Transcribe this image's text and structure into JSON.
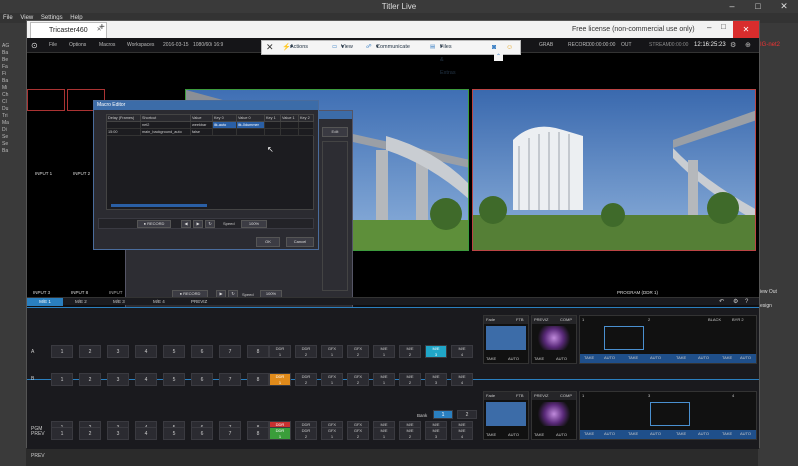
{
  "outer": {
    "title": "Titler Live",
    "menu": [
      "File",
      "View",
      "Settings",
      "Help"
    ],
    "left_items": [
      "AG",
      "Ba",
      "Be",
      "Fa",
      "Fi",
      "Ba",
      "Mi",
      "Ch",
      "Cl",
      "Du",
      "Tri",
      "Ma",
      "Di",
      "Se",
      "Se",
      "Ba"
    ],
    "right_items": [
      "iew Out",
      "esign"
    ]
  },
  "app": {
    "tab_label": "Tricaster460",
    "new_tab_symbol": "+",
    "license_text": "Free license (non-commercial use only)",
    "menu": [
      "File",
      "Options",
      "Macros",
      "Workspaces",
      "2016-03-15",
      "1080/60i 16:9"
    ],
    "status": {
      "grab": "GRAB",
      "record": "RECORD",
      "record_time": "00:00:00:00",
      "out": "OUT",
      "stream": "STREAM",
      "stream_time": "00:00:00",
      "clock": "12:16:25:23"
    }
  },
  "toolbar": {
    "close": "✕",
    "items": [
      "Actions",
      "View",
      "Communicate",
      "Files & Extras"
    ]
  },
  "labels": {
    "input1": "INPUT 1",
    "input2": "INPUT 2",
    "input3": "INPUT 3",
    "input8": "INPUT 8",
    "program": "PROGRAM (DDR 1)",
    "net2": "IG-net2"
  },
  "macro_dialog": {
    "title": "Macro Editor",
    "headers": [
      "Delay (Frames)",
      "Shortcut",
      "Value",
      "Key 0",
      "Value 0",
      "Key 1",
      "Value 1",
      "Key 2"
    ],
    "rows": [
      [
        "",
        "net2",
        "weekbar",
        "ilk-auto",
        "ilk-0dummer",
        "",
        "",
        ""
      ],
      [
        "15:00",
        "main_background_auto",
        "false",
        "",
        "",
        "",
        "",
        ""
      ]
    ],
    "record_label": "RECORD",
    "speed_label": "Speed",
    "speed_value": "100%",
    "ok": "OK",
    "cancel": "Cancel"
  },
  "bg_dialog": {
    "record_label": "RECORD",
    "speed_label": "Speed",
    "speed_value": "100%",
    "close": "Close",
    "edit": "Edit"
  },
  "me_tabs": [
    "M/E 1",
    "M/E 2",
    "M/E 3",
    "M/E 4",
    "PREVIZ"
  ],
  "row_a": {
    "label": "A",
    "keys": [
      "1",
      "2",
      "3",
      "4",
      "5",
      "6",
      "7",
      "8"
    ],
    "dsks": [
      [
        "DDR",
        "1"
      ],
      [
        "DDR",
        "2"
      ],
      [
        "GFX",
        "1"
      ],
      [
        "GFX",
        "2"
      ],
      [
        "M/E",
        "1"
      ],
      [
        "M/E",
        "2"
      ],
      [
        "M/E",
        "3"
      ],
      [
        "M/E",
        "4"
      ]
    ]
  },
  "row_b": {
    "label": "B",
    "keys": [
      "1",
      "2",
      "3",
      "4",
      "5",
      "6",
      "7",
      "8"
    ],
    "dsks": [
      [
        "DDR",
        "1"
      ],
      [
        "DDR",
        "2"
      ],
      [
        "GFX",
        "1"
      ],
      [
        "GFX",
        "2"
      ],
      [
        "M/E",
        "1"
      ],
      [
        "M/E",
        "2"
      ],
      [
        "M/E",
        "3"
      ],
      [
        "M/E",
        "4"
      ]
    ]
  },
  "row_pgm": {
    "label": "PGM",
    "keys": [
      "1",
      "2",
      "3",
      "4",
      "5",
      "6",
      "7",
      "8"
    ],
    "dsks": [
      [
        "DDR",
        "1"
      ],
      [
        "DDR",
        "2"
      ],
      [
        "GFX",
        "1"
      ],
      [
        "GFX",
        "2"
      ],
      [
        "M/E",
        "1"
      ],
      [
        "M/E",
        "2"
      ],
      [
        "M/E",
        "3"
      ],
      [
        "M/E",
        "4"
      ]
    ]
  },
  "row_prev": {
    "label": "PREV",
    "keys": [
      "1",
      "2",
      "3",
      "4",
      "5",
      "6",
      "7",
      "8"
    ],
    "dsks": [
      [
        "DDR",
        "1"
      ],
      [
        "DDR",
        "2"
      ],
      [
        "GFX",
        "1"
      ],
      [
        "GFX",
        "2"
      ],
      [
        "M/E",
        "1"
      ],
      [
        "M/E",
        "2"
      ],
      [
        "M/E",
        "3"
      ],
      [
        "M/E",
        "4"
      ]
    ]
  },
  "bank": {
    "label": "Bank",
    "b1": "1",
    "b2": "2"
  },
  "transitions": {
    "fade": "Fade",
    "ftb": "FTB",
    "previz": "PREVIZ",
    "comp": "COMP",
    "black": "BLACK",
    "byr": "BYR 2",
    "time": "00,00",
    "take": "TAKE",
    "auto": "AUTO",
    "d1": "1",
    "d2": "2",
    "d3": "3",
    "d4": "4"
  },
  "colors": {
    "accent": "#2a7fbf",
    "selected": "#20a6c8",
    "orange": "#e08a1a",
    "red": "#c83030",
    "green": "#3a9e3a"
  }
}
